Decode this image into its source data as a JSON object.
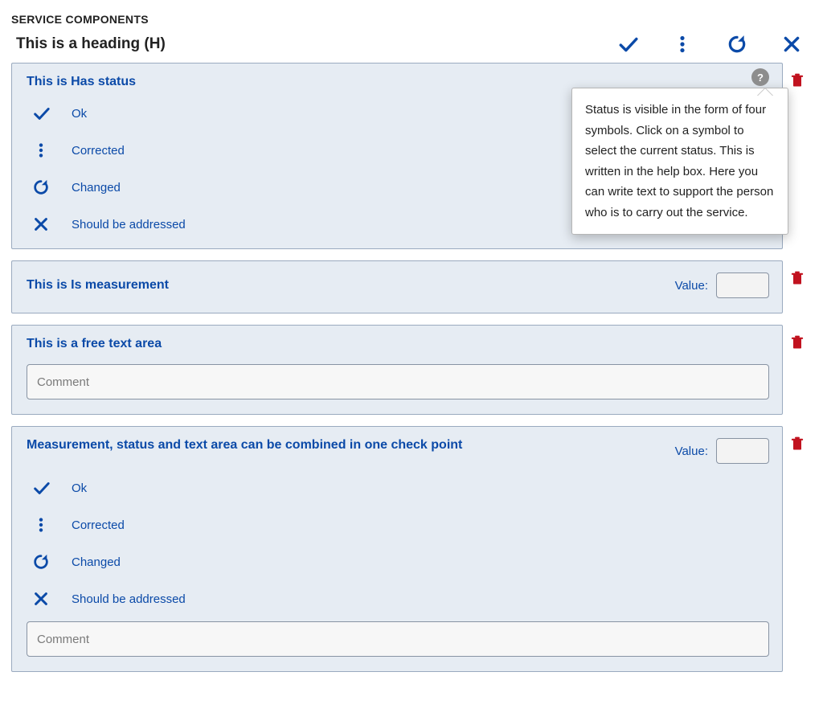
{
  "section_label": "SERVICE COMPONENTS",
  "heading": "This is a heading (H)",
  "header_icons": {
    "ok": "check-icon",
    "corrected": "dots-vertical-icon",
    "changed": "refresh-icon",
    "addressed": "close-icon"
  },
  "help_badge": "?",
  "tooltip_text": "Status is visible in the form of four symbols. Click on a symbol to select the current status. This is written in the help box. Here you can write text to support the person who is to carry out the service.",
  "value_label": "Value:",
  "comment_placeholder": "Comment",
  "status_options": [
    {
      "key": "ok",
      "label": "Ok",
      "icon": "check-icon"
    },
    {
      "key": "corrected",
      "label": "Corrected",
      "icon": "dots-vertical-icon"
    },
    {
      "key": "changed",
      "label": "Changed",
      "icon": "refresh-icon"
    },
    {
      "key": "addressed",
      "label": "Should be addressed",
      "icon": "close-icon"
    }
  ],
  "cards": [
    {
      "title": "This is Has status",
      "has_status": true,
      "has_value": false,
      "has_comment": false,
      "has_help": true
    },
    {
      "title": "This is Is measurement",
      "has_status": false,
      "has_value": true,
      "has_comment": false,
      "has_help": false
    },
    {
      "title": "This is a free text area",
      "has_status": false,
      "has_value": false,
      "has_comment": true,
      "has_help": false
    },
    {
      "title": "Measurement, status and text area can be combined in one check point",
      "has_status": true,
      "has_value": true,
      "has_comment": true,
      "has_help": false
    }
  ],
  "colors": {
    "primary": "#0b4aa8",
    "card_bg": "#e6ecf3",
    "card_border": "#9aaabf",
    "danger": "#c1121f"
  }
}
